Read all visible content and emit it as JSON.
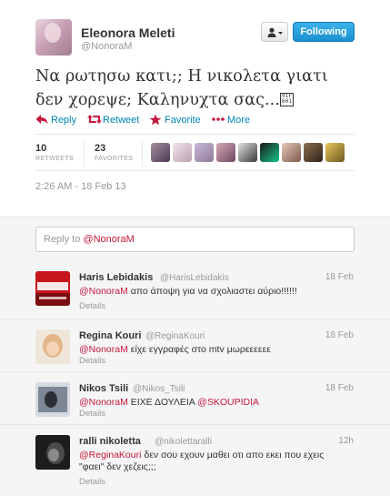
{
  "tweet": {
    "fullname": "Eleonora Meleti",
    "screen_name": "@NonoraM",
    "follow_label": "Following",
    "text": "Να ρωτησω κατι;; Η νικολετα γιατι δεν χορεψε; Καληνυχτα σας...",
    "unknown_glyph": "01F 601",
    "actions": {
      "reply": "Reply",
      "retweet": "Retweet",
      "favorite": "Favorite",
      "more": "More"
    },
    "stats": {
      "retweets_count": "10",
      "retweets_label": "RETWEETS",
      "favorites_count": "23",
      "favorites_label": "FAVORITES"
    },
    "timestamp": "2:26 AM - 18 Feb 13"
  },
  "reply_box": {
    "prefix": "Reply to ",
    "mention": "@NonoraM"
  },
  "replies": [
    {
      "name": "Haris Lebidakis",
      "screen_name": "@HarisLebidakis",
      "time": "18 Feb",
      "mention": "@NonoraM",
      "text": " απο άποψη για να σχολιαστει αύριο!!!!!!",
      "details": "Details"
    },
    {
      "name": "Regina Kouri",
      "screen_name": "@ReginaKouri",
      "time": "18 Feb",
      "mention": "@NonoraM",
      "text": " είχε εγγραφές στο mtv μωρεεεεεε",
      "details": "Details"
    },
    {
      "name": "Nikos Tsili",
      "screen_name": "@Nikos_Tsili",
      "time": "18 Feb",
      "mention": "@NonoraM",
      "text": " ΕΙΧΕ ΔΟΥΛΕΙΑ ",
      "mention2": "@SKOUPIDIA",
      "details": "Details"
    },
    {
      "name": "ralli nikoletta",
      "screen_name": "@nikolettaralli",
      "time": "12h",
      "mention": "@ReginaKouri",
      "text": " δεν σου εχουν μαθει οτι απο εκει που εχεις \"φαει\" δεν χεζεις;;;",
      "details": "Details"
    }
  ],
  "colors": {
    "link": "#0084B4",
    "mention": "#C4183C",
    "action_red": "#C4183C",
    "follow_btn": "#2EA2E0"
  }
}
